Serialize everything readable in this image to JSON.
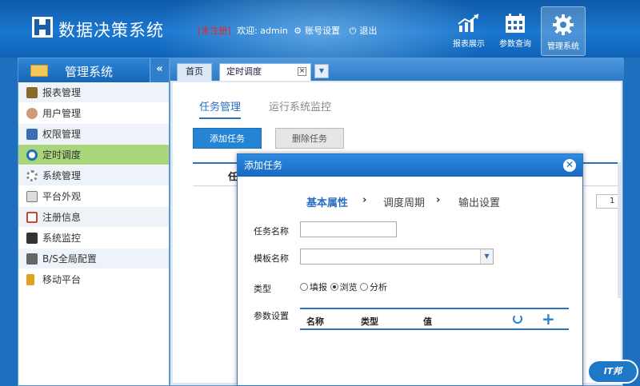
{
  "app": {
    "title": "数据决策系统",
    "unregistered": "[未注册]",
    "welcome": "欢迎: admin",
    "account_settings": "账号设置",
    "logout": "退出"
  },
  "topnav": [
    {
      "label": "报表展示"
    },
    {
      "label": "参数查询"
    },
    {
      "label": "管理系统"
    }
  ],
  "sidebar": {
    "title": "管理系统",
    "collapse": "«",
    "items": [
      {
        "label": "报表管理",
        "color": "#8a6a2a"
      },
      {
        "label": "用户管理",
        "color": "#d19a7a"
      },
      {
        "label": "权限管理",
        "color": "#3a6fb5"
      },
      {
        "label": "定时调度",
        "color": "#1d6fbf"
      },
      {
        "label": "系统管理",
        "color": "#888888"
      },
      {
        "label": "平台外观",
        "color": "#777777"
      },
      {
        "label": "注册信息",
        "color": "#c44a3a"
      },
      {
        "label": "系统监控",
        "color": "#333333"
      },
      {
        "label": "B/S全局配置",
        "color": "#666666"
      },
      {
        "label": "移动平台",
        "color": "#e0a020"
      }
    ]
  },
  "tabs": {
    "home": "首页",
    "current": "定时调度",
    "close": "×",
    "dropdown": "▼"
  },
  "main": {
    "subtabs": [
      "任务管理",
      "运行系统监控"
    ],
    "add_task": "添加任务",
    "delete_task": "删除任务",
    "task_column": "任务",
    "pager_value": "1"
  },
  "modal": {
    "title": "添加任务",
    "close": "✕",
    "steps": [
      "基本属性",
      "调度周期",
      "输出设置"
    ],
    "step_arrow": "›",
    "fields": {
      "task_name_label": "任务名称",
      "task_name_value": "",
      "template_label": "模板名称",
      "template_value": "",
      "type_label": "类型",
      "type_options": [
        "填报",
        "浏览",
        "分析"
      ],
      "type_selected": "浏览",
      "params_label": "参数设置"
    },
    "param_columns": [
      "名称",
      "类型",
      "值"
    ],
    "add_symbol": "+"
  },
  "watermark": "IT邦"
}
